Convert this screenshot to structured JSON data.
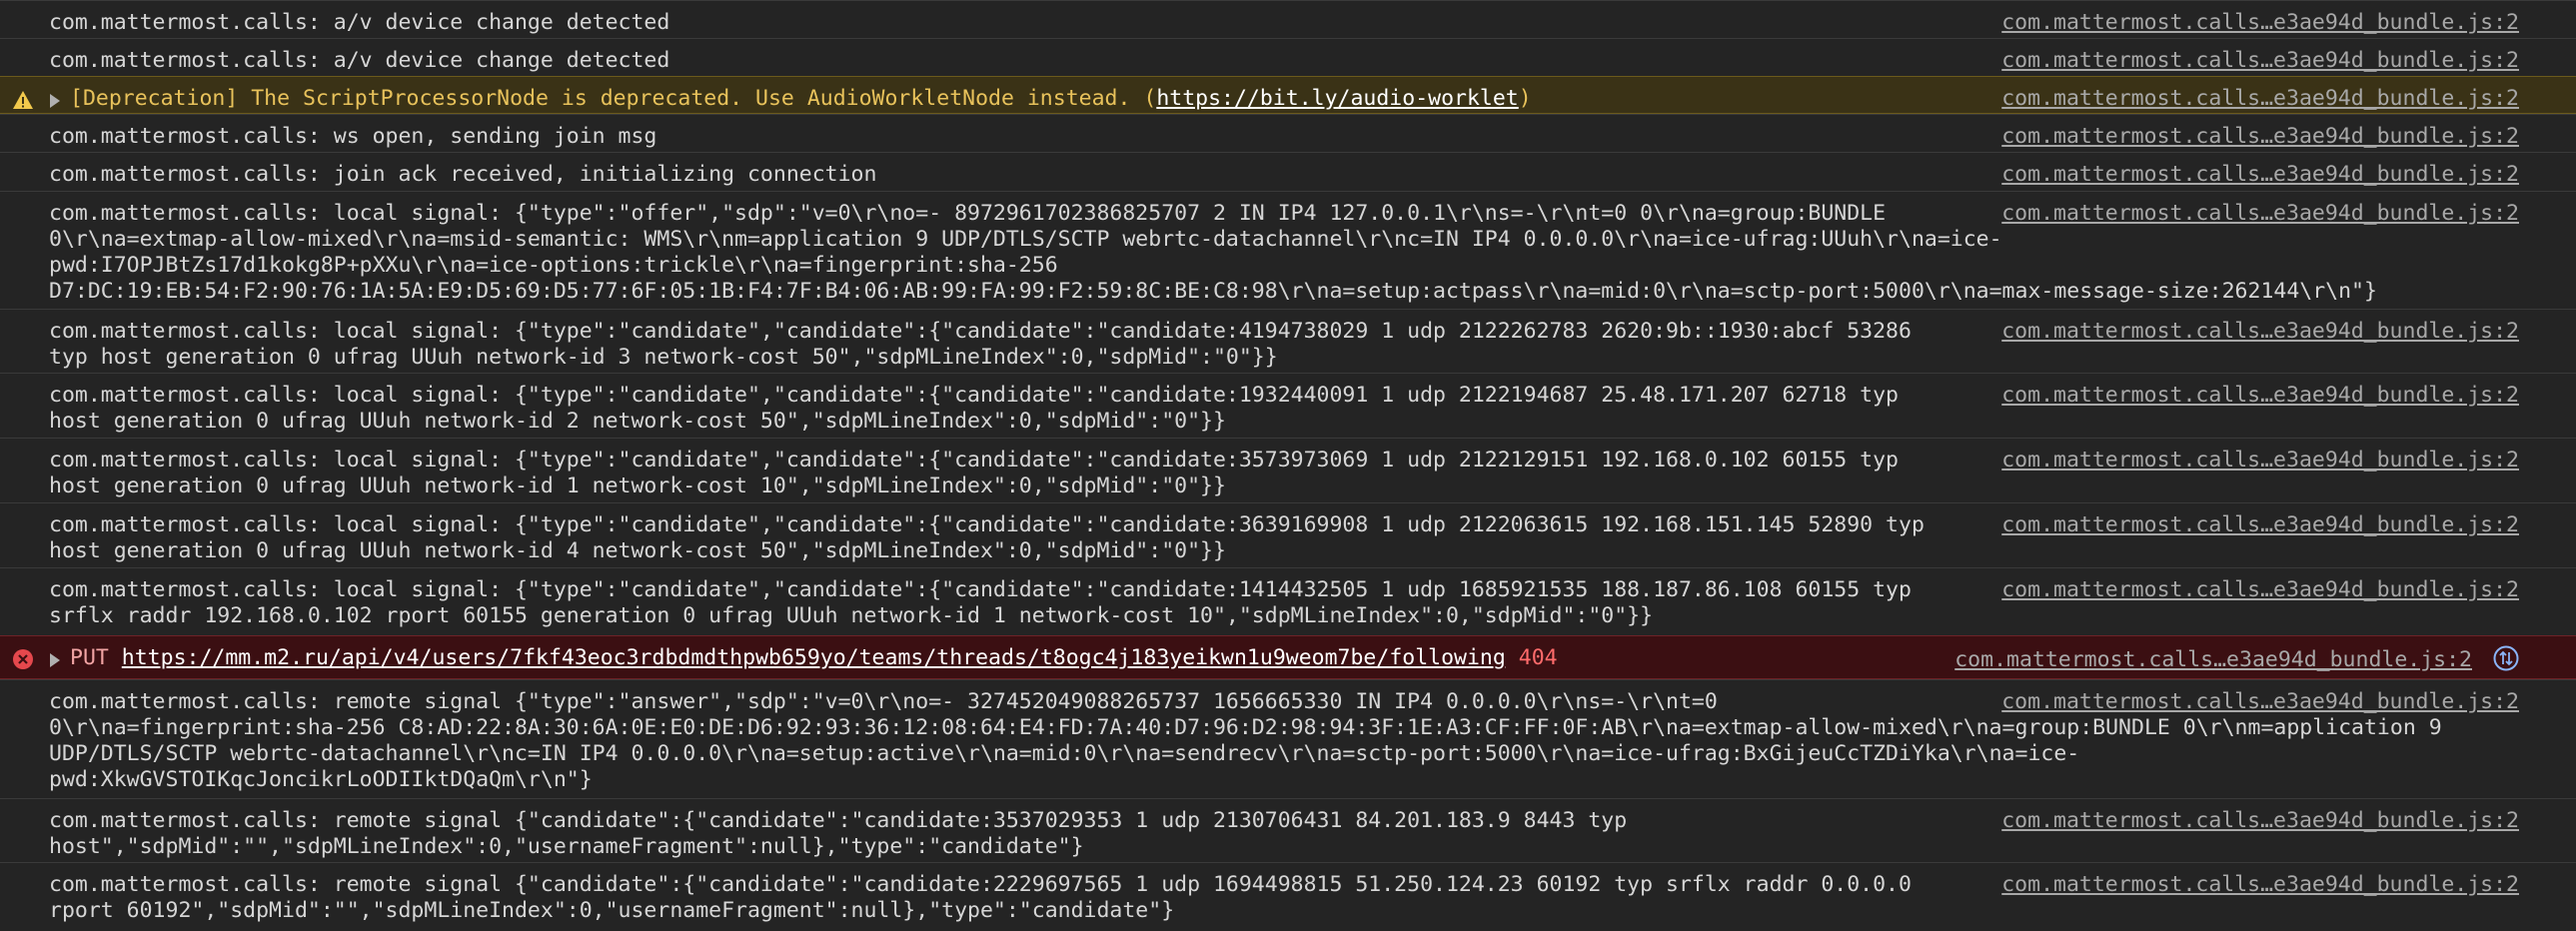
{
  "source": "com.mattermost.calls…e3ae94d_bundle.js:2",
  "rows": [
    {
      "type": "log",
      "lines": [
        "com.mattermost.calls: a/v device change detected"
      ]
    },
    {
      "type": "log",
      "lines": [
        "com.mattermost.calls: a/v device change detected"
      ]
    },
    {
      "type": "warning",
      "prefix": "[Deprecation] The ScriptProcessorNode is deprecated. Use AudioWorkletNode instead. (",
      "link": "https://bit.ly/audio-worklet",
      "suffix": ")"
    },
    {
      "type": "log",
      "lines": [
        "com.mattermost.calls: ws open, sending join msg"
      ]
    },
    {
      "type": "log",
      "lines": [
        "com.mattermost.calls: join ack received, initializing connection"
      ]
    },
    {
      "type": "log",
      "lines": [
        "com.mattermost.calls: local signal: {\"type\":\"offer\",\"sdp\":\"v=0\\r\\no=- 8972961702386825707 2 IN IP4 127.0.0.1\\r\\ns=-\\r\\nt=0 0\\r\\na=group:BUNDLE",
        "0\\r\\na=extmap-allow-mixed\\r\\na=msid-semantic: WMS\\r\\nm=application 9 UDP/DTLS/SCTP webrtc-datachannel\\r\\nc=IN IP4 0.0.0.0\\r\\na=ice-ufrag:UUuh\\r\\na=ice-",
        "pwd:I7OPJBtZs17d1kokg8P+pXXu\\r\\na=ice-options:trickle\\r\\na=fingerprint:sha-256",
        "D7:DC:19:EB:54:F2:90:76:1A:5A:E9:D5:69:D5:77:6F:05:1B:F4:7F:B4:06:AB:99:FA:99:F2:59:8C:BE:C8:98\\r\\na=setup:actpass\\r\\na=mid:0\\r\\na=sctp-port:5000\\r\\na=max-message-size:262144\\r\\n\"}"
      ]
    },
    {
      "type": "log",
      "lines": [
        "com.mattermost.calls: local signal: {\"type\":\"candidate\",\"candidate\":{\"candidate\":\"candidate:4194738029 1 udp 2122262783 2620:9b::1930:abcf 53286",
        "typ host generation 0 ufrag UUuh network-id 3 network-cost 50\",\"sdpMLineIndex\":0,\"sdpMid\":\"0\"}}"
      ]
    },
    {
      "type": "log",
      "lines": [
        "com.mattermost.calls: local signal: {\"type\":\"candidate\",\"candidate\":{\"candidate\":\"candidate:1932440091 1 udp 2122194687 25.48.171.207 62718 typ",
        "host generation 0 ufrag UUuh network-id 2 network-cost 50\",\"sdpMLineIndex\":0,\"sdpMid\":\"0\"}}"
      ]
    },
    {
      "type": "log",
      "lines": [
        "com.mattermost.calls: local signal: {\"type\":\"candidate\",\"candidate\":{\"candidate\":\"candidate:3573973069 1 udp 2122129151 192.168.0.102 60155 typ",
        "host generation 0 ufrag UUuh network-id 1 network-cost 10\",\"sdpMLineIndex\":0,\"sdpMid\":\"0\"}}"
      ]
    },
    {
      "type": "log",
      "lines": [
        "com.mattermost.calls: local signal: {\"type\":\"candidate\",\"candidate\":{\"candidate\":\"candidate:3639169908 1 udp 2122063615 192.168.151.145 52890 typ",
        "host generation 0 ufrag UUuh network-id 4 network-cost 50\",\"sdpMLineIndex\":0,\"sdpMid\":\"0\"}}"
      ]
    },
    {
      "type": "log",
      "lines": [
        "com.mattermost.calls: local signal: {\"type\":\"candidate\",\"candidate\":{\"candidate\":\"candidate:1414432505 1 udp 1685921535 188.187.86.108 60155 typ",
        "srflx raddr 192.168.0.102 rport 60155 generation 0 ufrag UUuh network-id 1 network-cost 10\",\"sdpMLineIndex\":0,\"sdpMid\":\"0\"}}"
      ]
    },
    {
      "type": "error",
      "method": "PUT",
      "link": "https://mm.m2.ru/api/v4/users/7fkf43eoc3rdbdmdthpwb659yo/teams/threads/t8ogc4j183yeikwn1u9weom7be/following",
      "status": "404"
    },
    {
      "type": "log",
      "lines": [
        "com.mattermost.calls: remote signal {\"type\":\"answer\",\"sdp\":\"v=0\\r\\no=- 327452049088265737 1656665330 IN IP4 0.0.0.0\\r\\ns=-\\r\\nt=0",
        "0\\r\\na=fingerprint:sha-256 C8:AD:22:8A:30:6A:0E:E0:DE:D6:92:93:36:12:08:64:E4:FD:7A:40:D7:96:D2:98:94:3F:1E:A3:CF:FF:0F:AB\\r\\na=extmap-allow-mixed\\r\\na=group:BUNDLE 0\\r\\nm=application 9",
        "UDP/DTLS/SCTP webrtc-datachannel\\r\\nc=IN IP4 0.0.0.0\\r\\na=setup:active\\r\\na=mid:0\\r\\na=sendrecv\\r\\na=sctp-port:5000\\r\\na=ice-ufrag:BxGijeuCcTZDiYka\\r\\na=ice-",
        "pwd:XkwGVSTOIKqcJoncikrLoODIIktDQaQm\\r\\n\"}"
      ]
    },
    {
      "type": "log",
      "lines": [
        "com.mattermost.calls: remote signal {\"candidate\":{\"candidate\":\"candidate:3537029353 1 udp 2130706431 84.201.183.9 8443 typ",
        "host\",\"sdpMid\":\"\",\"sdpMLineIndex\":0,\"usernameFragment\":null},\"type\":\"candidate\"}"
      ]
    },
    {
      "type": "log",
      "lines": [
        "com.mattermost.calls: remote signal {\"candidate\":{\"candidate\":\"candidate:2229697565 1 udp 1694498815 51.250.124.23 60192 typ srflx raddr 0.0.0.0",
        "rport 60192\",\"sdpMid\":\"\",\"sdpMLineIndex\":0,\"usernameFragment\":null},\"type\":\"candidate\"}"
      ]
    }
  ]
}
